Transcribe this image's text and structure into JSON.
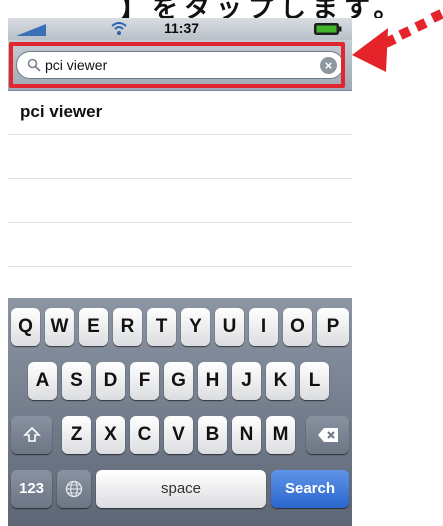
{
  "caption_fragment": "】をタップします。",
  "status_bar": {
    "time": "11:37"
  },
  "search": {
    "query": "pci viewer"
  },
  "results": [
    {
      "label": "pci viewer"
    }
  ],
  "keyboard": {
    "row1": [
      "Q",
      "W",
      "E",
      "R",
      "T",
      "Y",
      "U",
      "I",
      "O",
      "P"
    ],
    "row2": [
      "A",
      "S",
      "D",
      "F",
      "G",
      "H",
      "J",
      "K",
      "L"
    ],
    "row3": [
      "Z",
      "X",
      "C",
      "V",
      "B",
      "N",
      "M"
    ],
    "numbers_key": "123",
    "space_key": "space",
    "search_key": "Search"
  },
  "icons": {
    "signal": "signal-bars-icon",
    "wifi": "wifi-icon",
    "battery": "battery-icon",
    "search": "search-icon",
    "clear": "clear-icon",
    "shift": "shift-icon",
    "delete": "delete-icon",
    "globe": "globe-icon",
    "pointer": "dotted-arrow-icon"
  },
  "colors": {
    "highlight": "#e0262f",
    "search_key": "#2a66cc"
  }
}
